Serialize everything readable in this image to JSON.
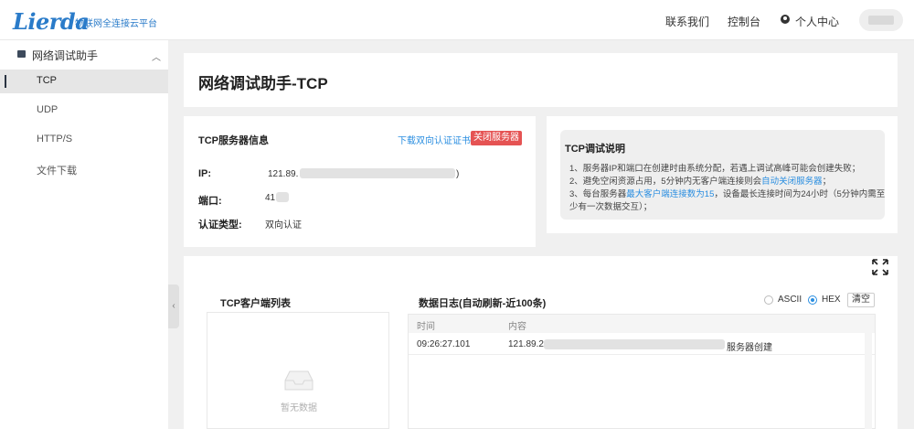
{
  "header": {
    "logo_text": "Lierda",
    "logo_subtitle": "物联网全连接云平台",
    "nav": {
      "contact": "联系我们",
      "console": "控制台",
      "profile": "个人中心"
    }
  },
  "sidebar": {
    "group_label": "网络调试助手",
    "items": [
      {
        "label": "TCP",
        "active": true
      },
      {
        "label": "UDP",
        "active": false
      },
      {
        "label": "HTTP/S",
        "active": false
      },
      {
        "label": "文件下载",
        "active": false
      }
    ]
  },
  "page": {
    "title": "网络调试助手-TCP"
  },
  "server_info": {
    "title": "TCP服务器信息",
    "download_link": "下载双向认证证书",
    "close_button": "关闭服务器",
    "ip_label": "IP:",
    "ip_value_prefix": "121.89.",
    "ip_value_suffix": ")",
    "port_label": "端口:",
    "port_value_prefix": "41",
    "auth_label": "认证类型:",
    "auth_value": "双向认证"
  },
  "notes": {
    "title": "TCP调试说明",
    "line1": "1、服务器IP和端口在创建时由系统分配，若遇上调试高峰可能会创建失败；",
    "line2_pre": "2、避免空闲资源占用，5分钟内无客户端连接则会",
    "line2_hl": "自动关闭服务器",
    "line2_post": "；",
    "line3_pre": "3、每台服务器",
    "line3_hl": "最大客户端连接数为15",
    "line3_post": "，设备最长连接时间为24小时（5分钟内需至",
    "line4": "少有一次数据交互）；"
  },
  "clients": {
    "title": "TCP客户端列表",
    "empty_text": "暂无数据"
  },
  "log": {
    "title": "数据日志(自动刷新-近100条)",
    "format_options": [
      "ASCII",
      "HEX"
    ],
    "selected_format": "HEX",
    "clear_button": "清空",
    "columns": [
      "时间",
      "内容"
    ],
    "rows": [
      {
        "time": "09:26:27.101",
        "content_prefix": "121.89.2",
        "content_suffix": "服务器创建"
      }
    ]
  },
  "colors": {
    "brand": "#2a7bc9",
    "link": "#2a8ee0",
    "danger": "#e55353"
  }
}
